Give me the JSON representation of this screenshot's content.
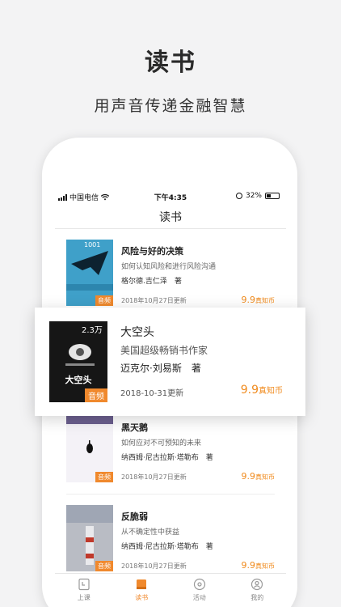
{
  "hero": {
    "title": "读书",
    "subtitle": "用声音传递金融智慧"
  },
  "statusbar": {
    "carrier": "中国电信",
    "time": "下午4:35",
    "battery": "32%"
  },
  "nav": {
    "title": "读书"
  },
  "books": [
    {
      "title": "风险与好的决策",
      "desc": "如何认知风险和进行风险沟通",
      "author": "格尔德.吉仁泽　著",
      "date": "2018年10月27日更新",
      "price": "9.9",
      "unit": "真知币",
      "badge": "音频",
      "count": "1001"
    },
    {
      "title": "大空头",
      "desc": "美国超级畅销书作家",
      "author": "迈克尔·刘易斯　著",
      "date": "2018-10-31更新",
      "price": "9.9",
      "unit": "真知币",
      "badge": "音频",
      "count": "2.3万"
    },
    {
      "title": "黑天鹅",
      "desc": "如何应对不可预知的未来",
      "author": "纳西姆·尼古拉斯·塔勒布　著",
      "date": "2018年10月27日更新",
      "price": "9.9",
      "unit": "真知币",
      "badge": "音频"
    },
    {
      "title": "反脆弱",
      "desc": "从不确定性中获益",
      "author": "纳西姆·尼古拉斯·塔勒布　著",
      "date": "2018年10月27日更新",
      "price": "9.9",
      "unit": "真知币",
      "badge": "音频"
    }
  ],
  "tabs": [
    {
      "label": "上课",
      "icon": "lesson-icon"
    },
    {
      "label": "读书",
      "icon": "book-icon",
      "active": true
    },
    {
      "label": "活动",
      "icon": "activity-icon"
    },
    {
      "label": "我的",
      "icon": "profile-icon"
    }
  ],
  "colors": {
    "accent": "#f08a1c",
    "badge": "#f0892d"
  }
}
